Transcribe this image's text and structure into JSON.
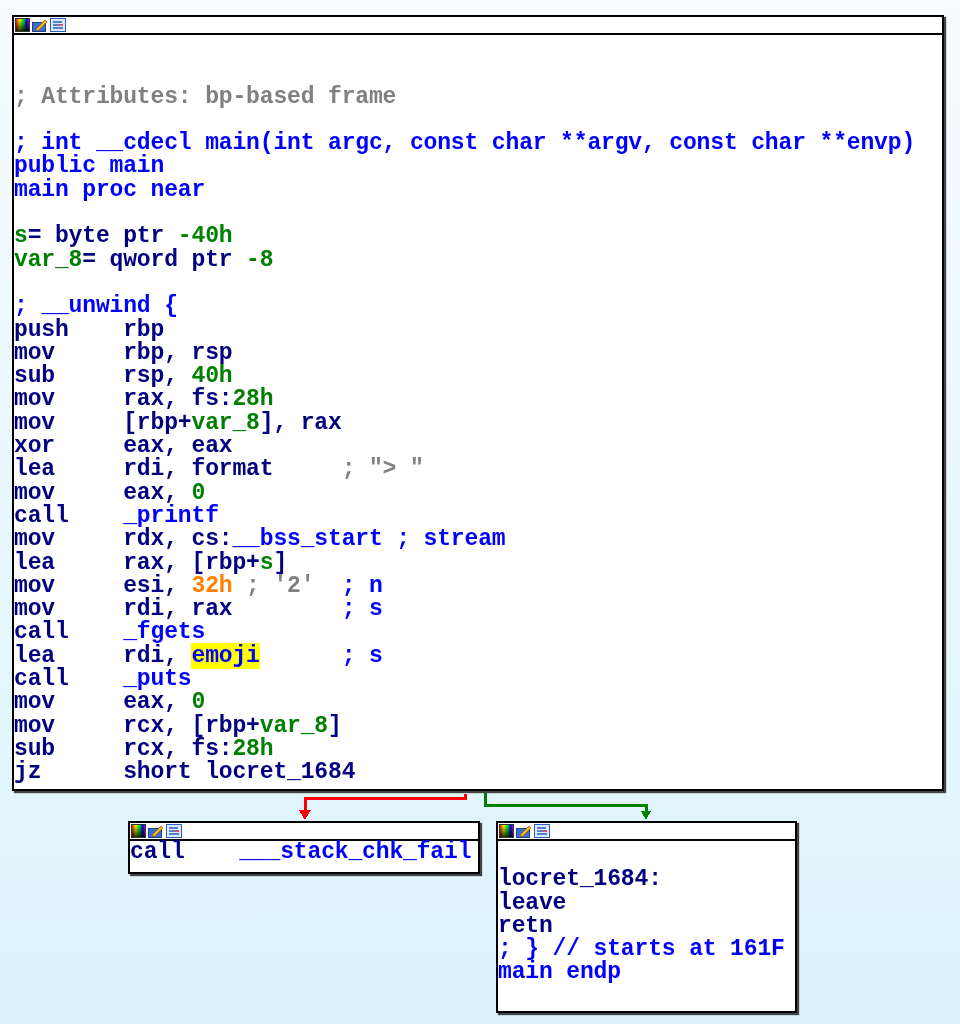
{
  "nodes": [
    {
      "lines": [
        {
          "kind": "blank"
        },
        {
          "kind": "blank"
        },
        {
          "kind": "code",
          "segments": [
            {
              "kind": "auto_comment",
              "text": "; Attributes: bp-based frame"
            }
          ]
        },
        {
          "kind": "blank"
        },
        {
          "kind": "code",
          "segments": [
            {
              "kind": "name",
              "text": "; int __cdecl main(int argc, const char **argv, const char **envp)"
            }
          ]
        },
        {
          "kind": "code",
          "segments": [
            {
              "kind": "name",
              "text": "public main"
            }
          ]
        },
        {
          "kind": "code",
          "segments": [
            {
              "kind": "name",
              "text": "main proc near"
            }
          ]
        },
        {
          "kind": "blank"
        },
        {
          "kind": "code",
          "segments": [
            {
              "kind": "number",
              "text": "s"
            },
            {
              "kind": "plain",
              "text": "= byte ptr "
            },
            {
              "kind": "number",
              "text": "-40h"
            }
          ]
        },
        {
          "kind": "code",
          "segments": [
            {
              "kind": "number",
              "text": "var_8"
            },
            {
              "kind": "plain",
              "text": "= qword ptr "
            },
            {
              "kind": "number",
              "text": "-8"
            }
          ]
        },
        {
          "kind": "blank"
        },
        {
          "kind": "code",
          "segments": [
            {
              "kind": "name",
              "text": "; __unwind {"
            }
          ]
        },
        {
          "kind": "code",
          "segments": [
            {
              "kind": "plain",
              "text": "push    rbp"
            }
          ]
        },
        {
          "kind": "code",
          "segments": [
            {
              "kind": "plain",
              "text": "mov     rbp, rsp"
            }
          ]
        },
        {
          "kind": "code",
          "segments": [
            {
              "kind": "plain",
              "text": "sub     rsp, "
            },
            {
              "kind": "number",
              "text": "40h"
            }
          ]
        },
        {
          "kind": "code",
          "segments": [
            {
              "kind": "plain",
              "text": "mov     rax, fs:"
            },
            {
              "kind": "number",
              "text": "28h"
            }
          ]
        },
        {
          "kind": "code",
          "segments": [
            {
              "kind": "plain",
              "text": "mov     [rbp+"
            },
            {
              "kind": "number",
              "text": "var_8"
            },
            {
              "kind": "plain",
              "text": "], rax"
            }
          ]
        },
        {
          "kind": "code",
          "segments": [
            {
              "kind": "plain",
              "text": "xor     eax, eax"
            }
          ]
        },
        {
          "kind": "code",
          "segments": [
            {
              "kind": "plain",
              "text": "lea     rdi, format     "
            },
            {
              "kind": "auto_comment",
              "text": "; \"> \""
            }
          ]
        },
        {
          "kind": "code",
          "segments": [
            {
              "kind": "plain",
              "text": "mov     eax, "
            },
            {
              "kind": "number",
              "text": "0"
            }
          ]
        },
        {
          "kind": "code",
          "segments": [
            {
              "kind": "plain",
              "text": "call    "
            },
            {
              "kind": "name",
              "text": "_printf"
            }
          ]
        },
        {
          "kind": "code",
          "segments": [
            {
              "kind": "plain",
              "text": "mov     rdx, cs:"
            },
            {
              "kind": "name",
              "text": "__bss_start ; stream"
            }
          ]
        },
        {
          "kind": "code",
          "segments": [
            {
              "kind": "plain",
              "text": "lea     rax, [rbp+"
            },
            {
              "kind": "number",
              "text": "s"
            },
            {
              "kind": "plain",
              "text": "]"
            }
          ]
        },
        {
          "kind": "code",
          "segments": [
            {
              "kind": "plain",
              "text": "mov     esi, "
            },
            {
              "kind": "constant",
              "text": "32h"
            },
            {
              "kind": "auto_comment",
              "text": " ; '2'"
            },
            {
              "kind": "name",
              "text": "  ; n"
            }
          ]
        },
        {
          "kind": "code",
          "segments": [
            {
              "kind": "plain",
              "text": "mov     rdi, rax        "
            },
            {
              "kind": "name",
              "text": "; s"
            }
          ]
        },
        {
          "kind": "code",
          "segments": [
            {
              "kind": "plain",
              "text": "call    "
            },
            {
              "kind": "name",
              "text": "_fgets"
            }
          ]
        },
        {
          "kind": "code",
          "segments": [
            {
              "kind": "plain",
              "text": "lea     rdi, "
            },
            {
              "kind": "highlight",
              "text": "emoji"
            },
            {
              "kind": "name",
              "text": "      ; s"
            }
          ]
        },
        {
          "kind": "code",
          "segments": [
            {
              "kind": "plain",
              "text": "call    "
            },
            {
              "kind": "name",
              "text": "_puts"
            }
          ]
        },
        {
          "kind": "code",
          "segments": [
            {
              "kind": "plain",
              "text": "mov     eax, "
            },
            {
              "kind": "number",
              "text": "0"
            }
          ]
        },
        {
          "kind": "code",
          "segments": [
            {
              "kind": "plain",
              "text": "mov     rcx, [rbp+"
            },
            {
              "kind": "number",
              "text": "var_8"
            },
            {
              "kind": "plain",
              "text": "]"
            }
          ]
        },
        {
          "kind": "code",
          "segments": [
            {
              "kind": "plain",
              "text": "sub     rcx, fs:"
            },
            {
              "kind": "number",
              "text": "28h"
            }
          ]
        },
        {
          "kind": "code",
          "segments": [
            {
              "kind": "plain",
              "text": "jz      short locret_1684"
            }
          ]
        }
      ]
    },
    {
      "lines": [
        {
          "kind": "code",
          "segments": [
            {
              "kind": "plain",
              "text": "call    "
            },
            {
              "kind": "name",
              "text": "___stack_chk_fail"
            }
          ]
        }
      ]
    },
    {
      "lines": [
        {
          "kind": "blank"
        },
        {
          "kind": "code",
          "segments": [
            {
              "kind": "plain",
              "text": "locret_1684:"
            }
          ]
        },
        {
          "kind": "code",
          "segments": [
            {
              "kind": "plain",
              "text": "leave"
            }
          ]
        },
        {
          "kind": "code",
          "segments": [
            {
              "kind": "plain",
              "text": "retn"
            }
          ]
        },
        {
          "kind": "code",
          "segments": [
            {
              "kind": "name",
              "text": "; } // starts at 161F"
            }
          ]
        },
        {
          "kind": "code",
          "segments": [
            {
              "kind": "name",
              "text": "main endp"
            }
          ]
        }
      ]
    }
  ],
  "edges": [
    {
      "color": "#ff0000"
    },
    {
      "color": "#008000"
    }
  ]
}
